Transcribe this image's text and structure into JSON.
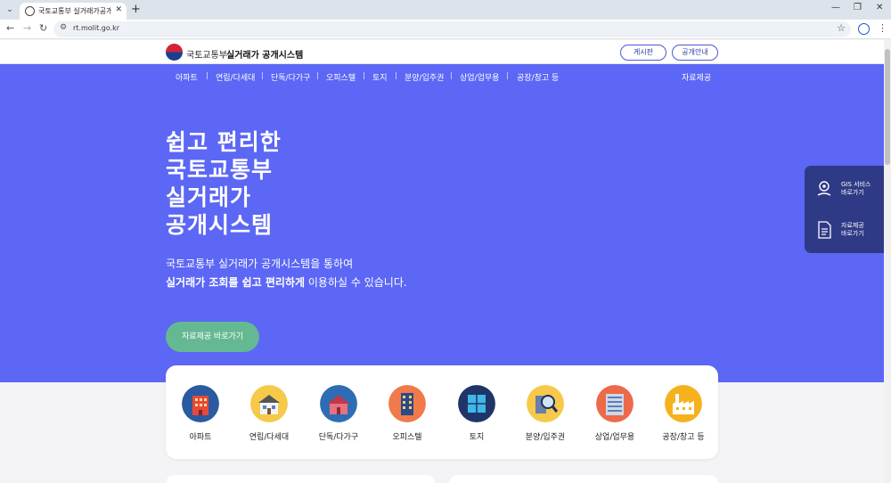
{
  "browser": {
    "tab_title": "국토교통부 실거래가공개시스템",
    "tab_close": "✕",
    "tab_list": "⌄",
    "new_tab": "+",
    "url": "rt.molit.go.kr",
    "win_min": "—",
    "win_max": "❐",
    "win_close": "✕"
  },
  "header": {
    "org": "국토교통부",
    "system": "실거래가 공개시스템",
    "btn_board": "게시판",
    "btn_guide": "공개안내"
  },
  "nav": {
    "items": [
      "아파트",
      "연립/다세대",
      "단독/다가구",
      "오피스텔",
      "토지",
      "분양/입주권",
      "상업/업무용",
      "공장/창고 등"
    ],
    "right": "자료제공"
  },
  "hero": {
    "title_lines": [
      "쉽고 편리한",
      "국토교통부",
      "실거래가",
      "공개시스템"
    ],
    "desc_line1": "국토교통부 실거래가 공개시스템을 통하여",
    "desc_bold": "실거래가 조회를 쉽고 편리하게",
    "desc_rest": " 이용하실 수 있습니다.",
    "cta": "자료제공 바로가기"
  },
  "quick": {
    "gis": "GIS 서비스\n바로가기",
    "data": "자료제공\n바로가기"
  },
  "categories": [
    {
      "label": "아파트",
      "icon": "apartment-icon",
      "bg": "#2a5aa0"
    },
    {
      "label": "연립/다세대",
      "icon": "row-house-icon",
      "bg": "#f6c94a"
    },
    {
      "label": "단독/다가구",
      "icon": "detached-house-icon",
      "bg": "#2d6db4"
    },
    {
      "label": "오피스텔",
      "icon": "officetel-icon",
      "bg": "#f07a4a"
    },
    {
      "label": "토지",
      "icon": "land-icon",
      "bg": "#1f3568"
    },
    {
      "label": "분양/입주권",
      "icon": "presale-search-icon",
      "bg": "#f6c94a"
    },
    {
      "label": "상업/업무용",
      "icon": "commercial-building-icon",
      "bg": "#ec6a4a"
    },
    {
      "label": "공장/창고 등",
      "icon": "factory-icon",
      "bg": "#f6b21c"
    }
  ],
  "colors": {
    "hero_bg": "#5c67f5",
    "cta_bg": "#65b992",
    "quick_panel_bg": "#2f3a86"
  }
}
